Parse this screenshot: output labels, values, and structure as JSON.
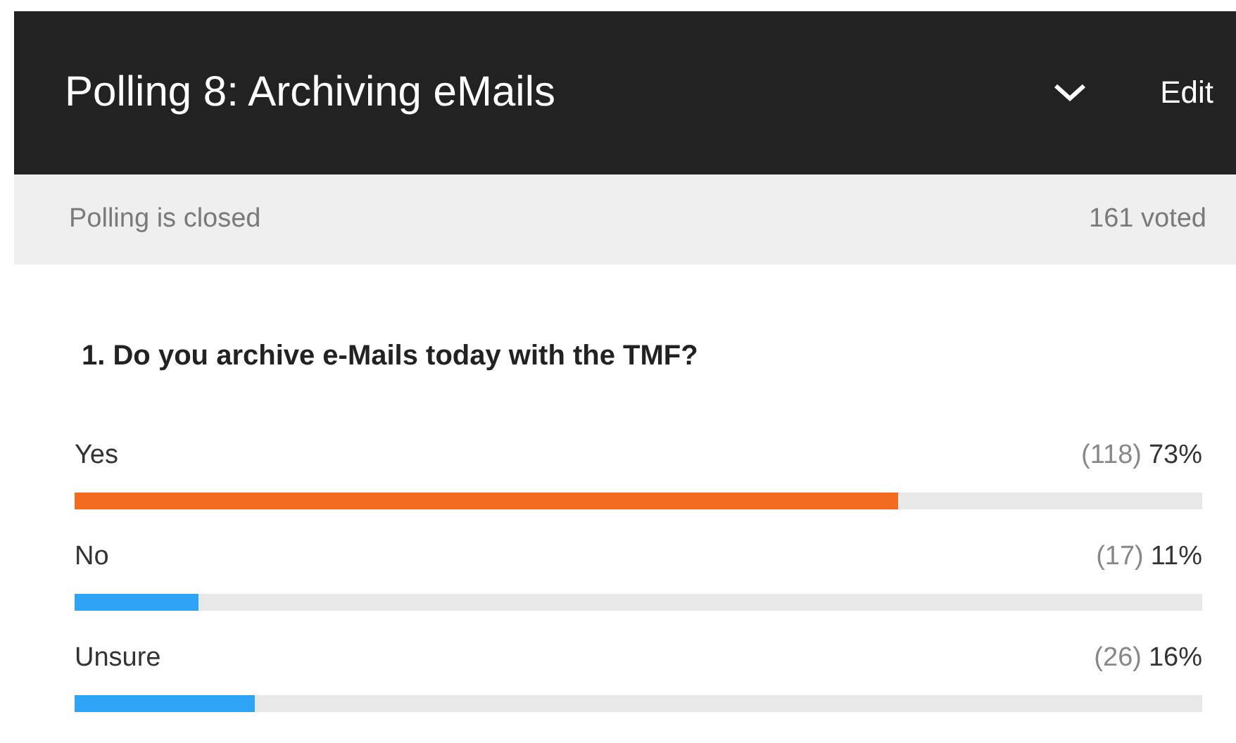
{
  "header": {
    "title": "Polling 8: Archiving eMails",
    "edit": "Edit"
  },
  "status": {
    "text": "Polling is closed",
    "voted": "161 voted"
  },
  "question": "1. Do you archive e-Mails today with the TMF?",
  "options": [
    {
      "label": "Yes",
      "count": "(118)",
      "percent": "73%",
      "level": 0.73,
      "color": "#f26b21"
    },
    {
      "label": "No",
      "count": "(17)",
      "percent": "11%",
      "level": 0.11,
      "color": "#2fa4f5"
    },
    {
      "label": "Unsure",
      "count": "(26)",
      "percent": "16%",
      "level": 0.16,
      "color": "#2fa4f5"
    }
  ]
}
